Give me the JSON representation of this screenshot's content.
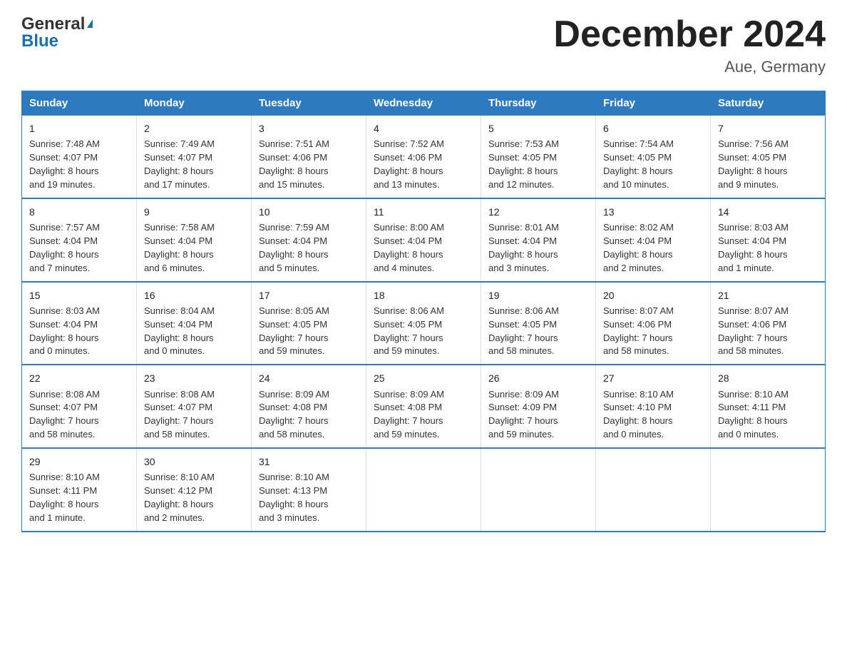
{
  "header": {
    "logo_line1": "General",
    "logo_line2": "Blue",
    "title": "December 2024",
    "location": "Aue, Germany"
  },
  "calendar": {
    "days_of_week": [
      "Sunday",
      "Monday",
      "Tuesday",
      "Wednesday",
      "Thursday",
      "Friday",
      "Saturday"
    ],
    "weeks": [
      [
        {
          "day": "1",
          "info": "Sunrise: 7:48 AM\nSunset: 4:07 PM\nDaylight: 8 hours\nand 19 minutes."
        },
        {
          "day": "2",
          "info": "Sunrise: 7:49 AM\nSunset: 4:07 PM\nDaylight: 8 hours\nand 17 minutes."
        },
        {
          "day": "3",
          "info": "Sunrise: 7:51 AM\nSunset: 4:06 PM\nDaylight: 8 hours\nand 15 minutes."
        },
        {
          "day": "4",
          "info": "Sunrise: 7:52 AM\nSunset: 4:06 PM\nDaylight: 8 hours\nand 13 minutes."
        },
        {
          "day": "5",
          "info": "Sunrise: 7:53 AM\nSunset: 4:05 PM\nDaylight: 8 hours\nand 12 minutes."
        },
        {
          "day": "6",
          "info": "Sunrise: 7:54 AM\nSunset: 4:05 PM\nDaylight: 8 hours\nand 10 minutes."
        },
        {
          "day": "7",
          "info": "Sunrise: 7:56 AM\nSunset: 4:05 PM\nDaylight: 8 hours\nand 9 minutes."
        }
      ],
      [
        {
          "day": "8",
          "info": "Sunrise: 7:57 AM\nSunset: 4:04 PM\nDaylight: 8 hours\nand 7 minutes."
        },
        {
          "day": "9",
          "info": "Sunrise: 7:58 AM\nSunset: 4:04 PM\nDaylight: 8 hours\nand 6 minutes."
        },
        {
          "day": "10",
          "info": "Sunrise: 7:59 AM\nSunset: 4:04 PM\nDaylight: 8 hours\nand 5 minutes."
        },
        {
          "day": "11",
          "info": "Sunrise: 8:00 AM\nSunset: 4:04 PM\nDaylight: 8 hours\nand 4 minutes."
        },
        {
          "day": "12",
          "info": "Sunrise: 8:01 AM\nSunset: 4:04 PM\nDaylight: 8 hours\nand 3 minutes."
        },
        {
          "day": "13",
          "info": "Sunrise: 8:02 AM\nSunset: 4:04 PM\nDaylight: 8 hours\nand 2 minutes."
        },
        {
          "day": "14",
          "info": "Sunrise: 8:03 AM\nSunset: 4:04 PM\nDaylight: 8 hours\nand 1 minute."
        }
      ],
      [
        {
          "day": "15",
          "info": "Sunrise: 8:03 AM\nSunset: 4:04 PM\nDaylight: 8 hours\nand 0 minutes."
        },
        {
          "day": "16",
          "info": "Sunrise: 8:04 AM\nSunset: 4:04 PM\nDaylight: 8 hours\nand 0 minutes."
        },
        {
          "day": "17",
          "info": "Sunrise: 8:05 AM\nSunset: 4:05 PM\nDaylight: 7 hours\nand 59 minutes."
        },
        {
          "day": "18",
          "info": "Sunrise: 8:06 AM\nSunset: 4:05 PM\nDaylight: 7 hours\nand 59 minutes."
        },
        {
          "day": "19",
          "info": "Sunrise: 8:06 AM\nSunset: 4:05 PM\nDaylight: 7 hours\nand 58 minutes."
        },
        {
          "day": "20",
          "info": "Sunrise: 8:07 AM\nSunset: 4:06 PM\nDaylight: 7 hours\nand 58 minutes."
        },
        {
          "day": "21",
          "info": "Sunrise: 8:07 AM\nSunset: 4:06 PM\nDaylight: 7 hours\nand 58 minutes."
        }
      ],
      [
        {
          "day": "22",
          "info": "Sunrise: 8:08 AM\nSunset: 4:07 PM\nDaylight: 7 hours\nand 58 minutes."
        },
        {
          "day": "23",
          "info": "Sunrise: 8:08 AM\nSunset: 4:07 PM\nDaylight: 7 hours\nand 58 minutes."
        },
        {
          "day": "24",
          "info": "Sunrise: 8:09 AM\nSunset: 4:08 PM\nDaylight: 7 hours\nand 58 minutes."
        },
        {
          "day": "25",
          "info": "Sunrise: 8:09 AM\nSunset: 4:08 PM\nDaylight: 7 hours\nand 59 minutes."
        },
        {
          "day": "26",
          "info": "Sunrise: 8:09 AM\nSunset: 4:09 PM\nDaylight: 7 hours\nand 59 minutes."
        },
        {
          "day": "27",
          "info": "Sunrise: 8:10 AM\nSunset: 4:10 PM\nDaylight: 8 hours\nand 0 minutes."
        },
        {
          "day": "28",
          "info": "Sunrise: 8:10 AM\nSunset: 4:11 PM\nDaylight: 8 hours\nand 0 minutes."
        }
      ],
      [
        {
          "day": "29",
          "info": "Sunrise: 8:10 AM\nSunset: 4:11 PM\nDaylight: 8 hours\nand 1 minute."
        },
        {
          "day": "30",
          "info": "Sunrise: 8:10 AM\nSunset: 4:12 PM\nDaylight: 8 hours\nand 2 minutes."
        },
        {
          "day": "31",
          "info": "Sunrise: 8:10 AM\nSunset: 4:13 PM\nDaylight: 8 hours\nand 3 minutes."
        },
        {
          "day": "",
          "info": ""
        },
        {
          "day": "",
          "info": ""
        },
        {
          "day": "",
          "info": ""
        },
        {
          "day": "",
          "info": ""
        }
      ]
    ]
  }
}
